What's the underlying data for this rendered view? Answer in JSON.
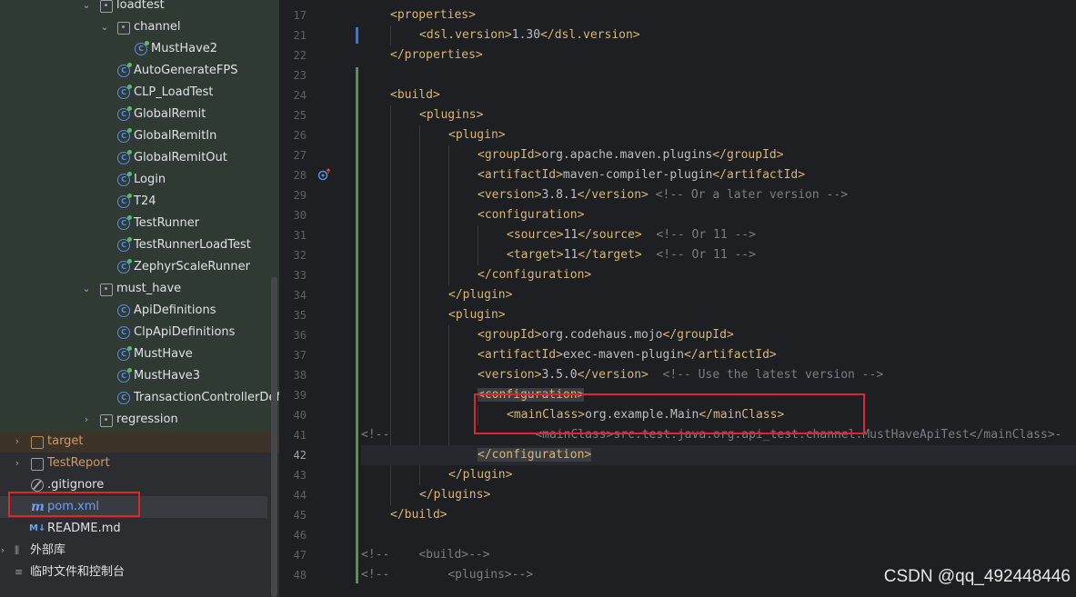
{
  "sidebar": {
    "folders": {
      "loadtest": "loadtest",
      "channel": "channel",
      "must_have": "must_have",
      "regression": "regression",
      "target": "target",
      "TestReport": "TestReport",
      "external": "外部库",
      "scratches": "临时文件和控制台"
    },
    "files": {
      "musthave2": "MustHave2",
      "autogen": "AutoGenerateFPS",
      "clp": "CLP_LoadTest",
      "globalremit": "GlobalRemit",
      "globalremitin": "GlobalRemitIn",
      "globalremitout": "GlobalRemitOut",
      "login": "Login",
      "t24": "T24",
      "testrunner": "TestRunner",
      "testrunnerload": "TestRunnerLoadTest",
      "zephyr": "ZephyrScaleRunner",
      "apidef": "ApiDefinitions",
      "clpapidef": "ClpApiDefinitions",
      "musthave": "MustHave",
      "musthave3": "MustHave3",
      "txctrl": "TransactionControllerDefini",
      "gitignore": ".gitignore",
      "pom": "pom.xml",
      "readme": "README.md"
    },
    "icon_glyphs": {
      "maven": "m",
      "markdown": "M↓",
      "class": "C",
      "library": "⫼"
    }
  },
  "editor": {
    "line_numbers": [
      "17",
      "21",
      "22",
      "23",
      "24",
      "25",
      "26",
      "27",
      "28",
      "29",
      "30",
      "31",
      "32",
      "33",
      "34",
      "35",
      "36",
      "37",
      "38",
      "39",
      "40",
      "41",
      "42",
      "43",
      "44",
      "45",
      "46",
      "47",
      "48"
    ],
    "current_line": "42",
    "code": {
      "l17": {
        "open": "<properties>"
      },
      "l21": {
        "open": "<dsl.version>",
        "text": "1.30",
        "close": "</dsl.version>"
      },
      "l22": {
        "close": "</properties>"
      },
      "l24": {
        "open": "<build>"
      },
      "l25": {
        "open": "<plugins>"
      },
      "l26": {
        "open": "<plugin>"
      },
      "l27": {
        "open": "<groupId>",
        "text": "org.apache.maven.plugins",
        "close": "</groupId>"
      },
      "l28": {
        "open": "<artifactId>",
        "text": "maven-compiler-plugin",
        "close": "</artifactId>"
      },
      "l29": {
        "open": "<version>",
        "text": "3.8.1",
        "close": "</version>",
        "comment": " <!-- Or a later version -->"
      },
      "l30": {
        "open": "<configuration>"
      },
      "l31": {
        "open": "<source>",
        "text": "11",
        "close": "</source>",
        "comment": "  <!-- Or 11 -->"
      },
      "l32": {
        "open": "<target>",
        "text": "11",
        "close": "</target>",
        "comment": "  <!-- Or 11 -->"
      },
      "l33": {
        "close": "</configuration>"
      },
      "l34": {
        "close": "</plugin>"
      },
      "l35": {
        "open": "<plugin>"
      },
      "l36": {
        "open": "<groupId>",
        "text": "org.codehaus.mojo",
        "close": "</groupId>"
      },
      "l37": {
        "open": "<artifactId>",
        "text": "exec-maven-plugin",
        "close": "</artifactId>"
      },
      "l38": {
        "open": "<version>",
        "text": "3.5.0",
        "close": "</version>",
        "comment": "  <!-- Use the latest version -->"
      },
      "l39": {
        "open": "<configuration>"
      },
      "l40": {
        "open": "<mainClass>",
        "text": "org.example.Main",
        "close": "</mainClass>"
      },
      "l41": {
        "comment_start": "<!--",
        "comment": "<mainClass>src.test.java.org.api_test.channel.MustHaveApiTest</mainClass>-"
      },
      "l42": {
        "close": "</configuration>"
      },
      "l43": {
        "close": "</plugin>"
      },
      "l44": {
        "close": "</plugins>"
      },
      "l45": {
        "close": "</build>"
      },
      "l47": {
        "comment_start": "<!--",
        "comment": "<build>-->"
      },
      "l48": {
        "comment_start": "<!--",
        "comment": "<plugins>-->"
      }
    }
  },
  "watermark": "CSDN @qq_492448446",
  "colors": {
    "tag": "#d5b778",
    "text": "#bcbec4",
    "comment": "#7a7e85",
    "highlight_box": "#e0262d",
    "change_bar": "#549159"
  }
}
